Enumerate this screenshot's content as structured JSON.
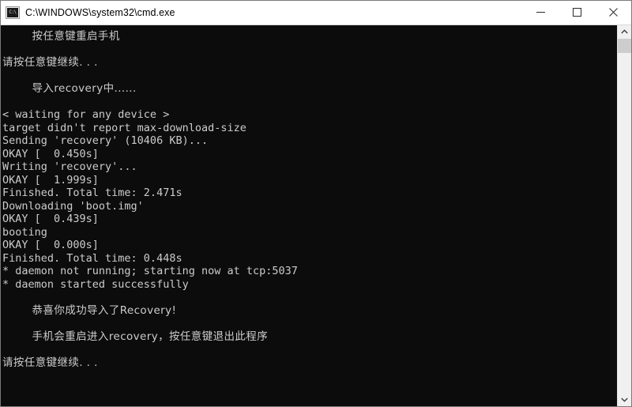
{
  "window": {
    "title": "C:\\WINDOWS\\system32\\cmd.exe",
    "icon": "cmd-console-icon",
    "icon_glyph": "C:\\",
    "background_color": "#0c0c0c",
    "text_color": "#cccccc",
    "titlebar_color": "#ffffff"
  },
  "titlebar_buttons": {
    "minimize": "minimize-icon",
    "maximize": "maximize-icon",
    "close": "close-icon"
  },
  "scrollbar": {
    "up_arrow": "scroll-up-arrow-icon",
    "down_arrow": "scroll-down-arrow-icon",
    "thumb_position_percent": 0,
    "thumb_size_percent": 4
  },
  "console": {
    "lines": [
      {
        "text": "        按任意键重启手机",
        "cjk": true
      },
      {
        "text": "",
        "cjk": false
      },
      {
        "text": "请按任意键继续. . .",
        "cjk": true
      },
      {
        "text": "",
        "cjk": false
      },
      {
        "text": "        导入recovery中......",
        "cjk": true
      },
      {
        "text": "",
        "cjk": false
      },
      {
        "text": "< waiting for any device >",
        "cjk": false
      },
      {
        "text": "target didn't report max-download-size",
        "cjk": false
      },
      {
        "text": "Sending 'recovery' (10406 KB)...",
        "cjk": false
      },
      {
        "text": "OKAY [  0.450s]",
        "cjk": false
      },
      {
        "text": "Writing 'recovery'...",
        "cjk": false
      },
      {
        "text": "OKAY [  1.999s]",
        "cjk": false
      },
      {
        "text": "Finished. Total time: 2.471s",
        "cjk": false
      },
      {
        "text": "Downloading 'boot.img'",
        "cjk": false
      },
      {
        "text": "OKAY [  0.439s]",
        "cjk": false
      },
      {
        "text": "booting",
        "cjk": false
      },
      {
        "text": "OKAY [  0.000s]",
        "cjk": false
      },
      {
        "text": "Finished. Total time: 0.448s",
        "cjk": false
      },
      {
        "text": "* daemon not running; starting now at tcp:5037",
        "cjk": false
      },
      {
        "text": "* daemon started successfully",
        "cjk": false
      },
      {
        "text": "",
        "cjk": false
      },
      {
        "text": "        恭喜你成功导入了Recovery!",
        "cjk": true
      },
      {
        "text": "",
        "cjk": false
      },
      {
        "text": "        手机会重启进入recovery，按任意键退出此程序",
        "cjk": true
      },
      {
        "text": "",
        "cjk": false
      },
      {
        "text": "请按任意键继续. . .",
        "cjk": true
      }
    ]
  }
}
